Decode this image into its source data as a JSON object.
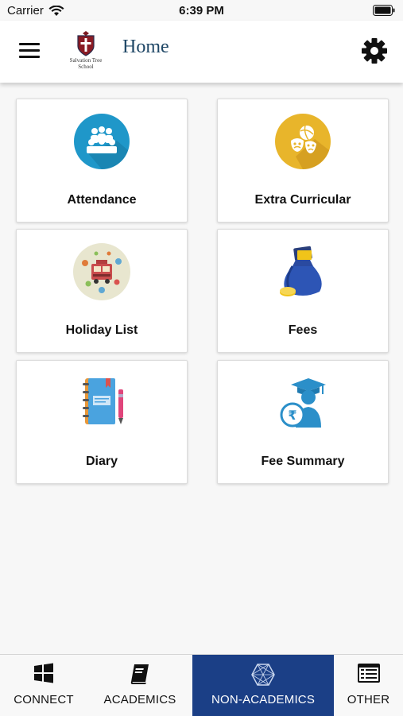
{
  "status_bar": {
    "carrier": "Carrier",
    "time": "6:39 PM"
  },
  "header": {
    "school_name_line1": "Salvation Tree",
    "school_name_line2": "School",
    "title": "Home"
  },
  "tiles": [
    {
      "label": "Attendance",
      "icon": "attendance-icon"
    },
    {
      "label": "Extra Curricular",
      "icon": "extra-curricular-icon"
    },
    {
      "label": "Holiday List",
      "icon": "holiday-list-icon"
    },
    {
      "label": "Fees",
      "icon": "fees-money-bag-icon"
    },
    {
      "label": "Diary",
      "icon": "diary-notebook-icon"
    },
    {
      "label": "Fee Summary",
      "icon": "fee-summary-graduate-icon"
    }
  ],
  "bottom_nav": [
    {
      "label": "CONNECT",
      "icon": "windows-grid-icon",
      "active": false
    },
    {
      "label": "ACADEMICS",
      "icon": "book-icon",
      "active": false
    },
    {
      "label": "NON-ACADEMICS",
      "icon": "hexagon-icon",
      "active": true
    },
    {
      "label": "OTHER",
      "icon": "list-window-icon",
      "active": false
    }
  ],
  "colors": {
    "header_title": "#1f4766",
    "nav_active_bg": "#1b3f86",
    "attendance_circle": "#1f97c9",
    "extra_curricular_circle": "#e8b52b"
  }
}
